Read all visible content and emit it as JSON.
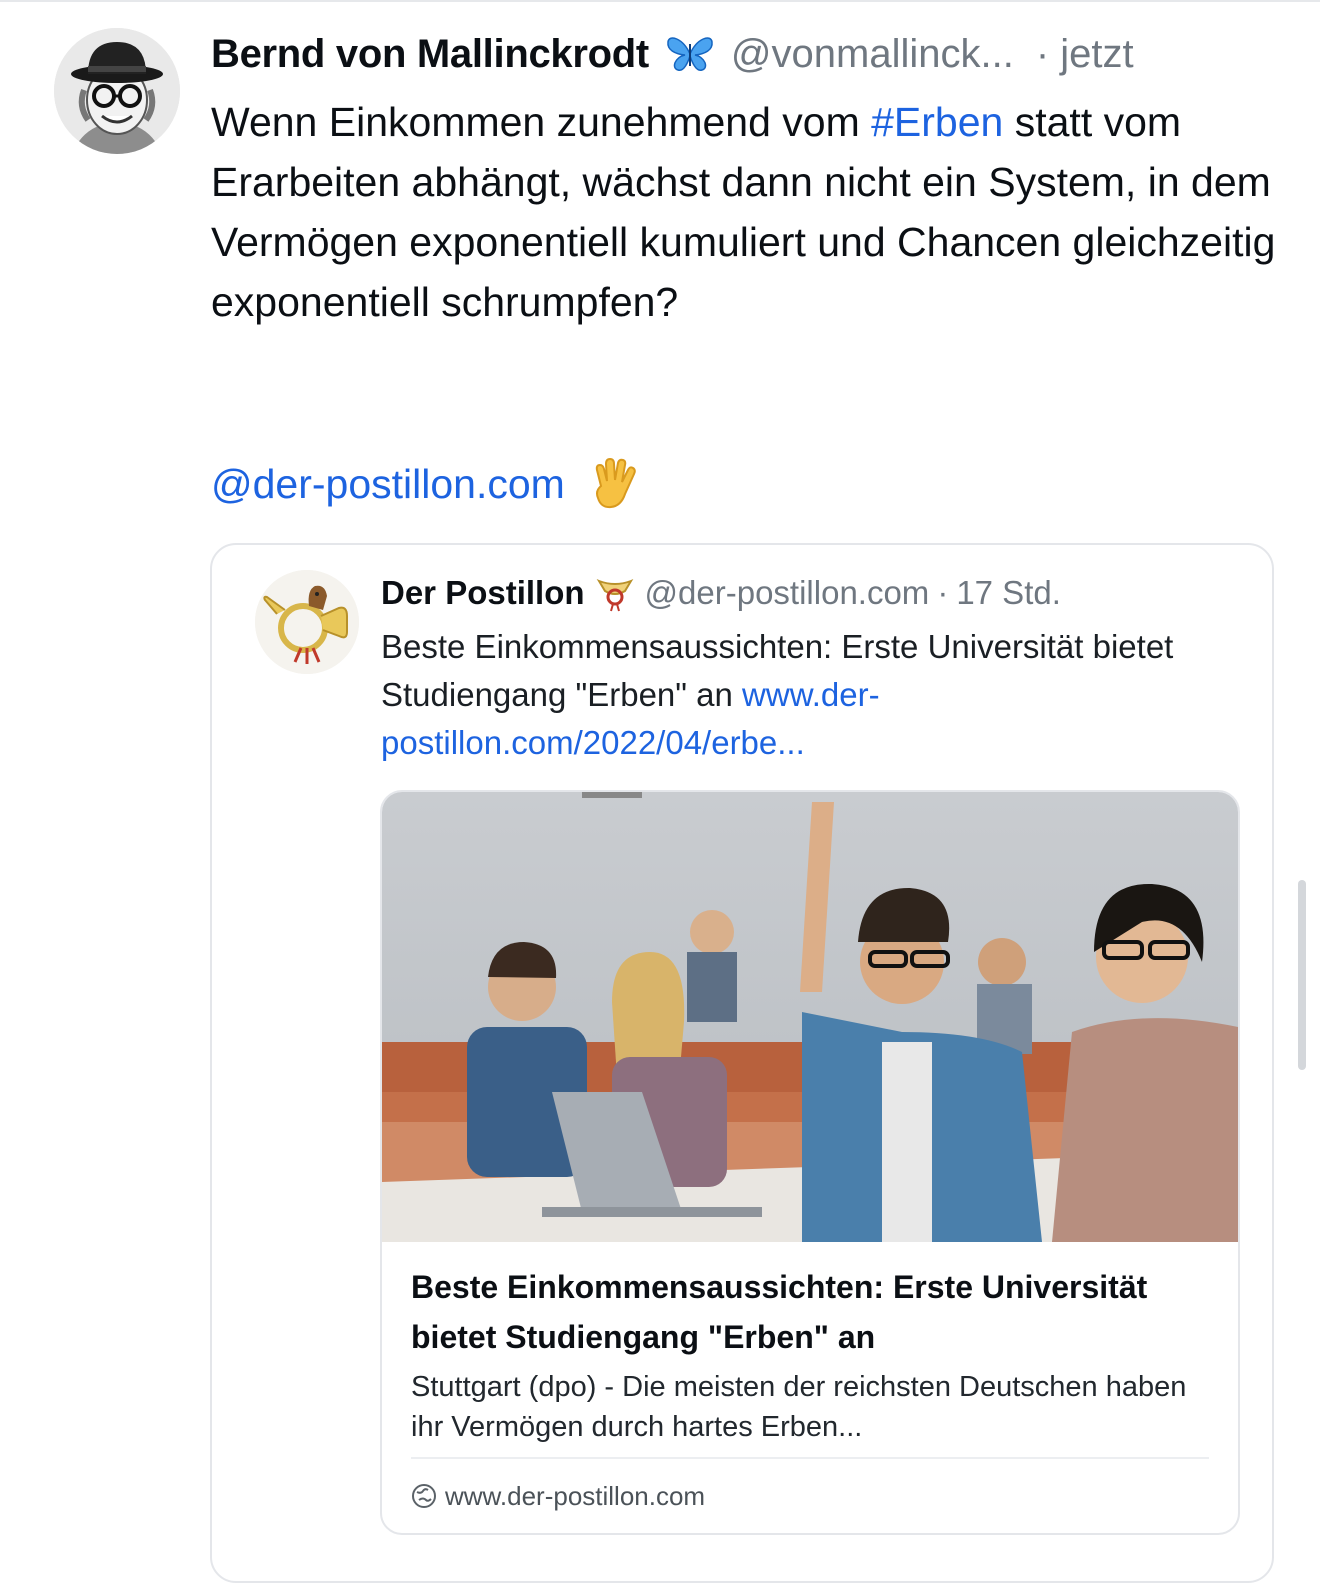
{
  "post": {
    "author_name": "Bernd von Mallinckrodt",
    "author_badge_icon": "butterfly-icon",
    "handle": "@vonmallinck...",
    "time": "· jetzt",
    "text_before": "Wenn Einkommen zunehmend vom ",
    "hashtag": "#Erben",
    "text_after": " statt vom Erarbeiten abhängt, wächst dann nicht ein System, in dem Vermögen exponentiell kumuliert und Chancen gleichzeitig exponentiell schrumpfen?",
    "mention": "@der-postillon.com",
    "mention_emoji_icon": "raised-hand-icon"
  },
  "quote": {
    "author_name": "Der Postillon",
    "author_badge_icon": "post-horn-icon",
    "handle": "@der-postillon.com",
    "separator": "·",
    "time": "17 Std.",
    "text": "Beste Einkommensaussichten: Erste Universität bietet Studiengang \"Erben\" an ",
    "link_text": "www.der-postillon.com/2022/04/erbe..."
  },
  "link_card": {
    "image_icon": "lecture-hall-photo",
    "title": "Beste Einkommensaussichten: Erste Universität bietet Studiengang \"Erben\" an",
    "description": "Stuttgart (dpo) - Die meisten der reichsten Deutschen haben ihr Vermögen durch hartes Erben...",
    "domain_icon": "globe-icon",
    "domain": "www.der-postillon.com"
  },
  "colors": {
    "link_blue": "#1d63e0",
    "muted_gray": "#6f7780",
    "border": "#e4e6ea"
  }
}
